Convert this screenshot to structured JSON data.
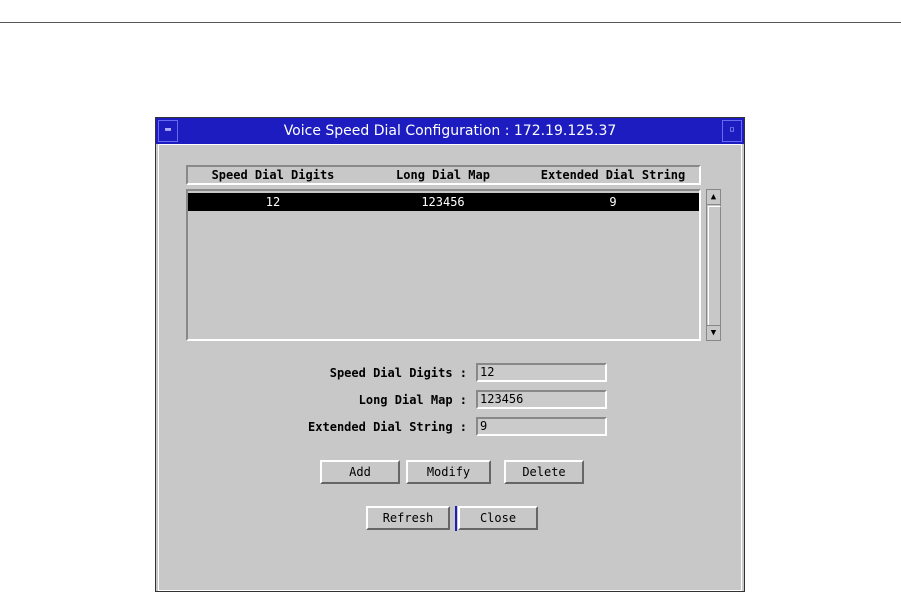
{
  "window": {
    "title": "Voice Speed Dial Configuration : 172.19.125.37",
    "menu_icon": "window-menu-icon",
    "maximize_icon": "maximize-icon"
  },
  "table": {
    "columns": [
      "Speed Dial Digits",
      "Long Dial Map",
      "Extended Dial String"
    ],
    "rows": [
      [
        "12",
        "123456",
        "9"
      ]
    ]
  },
  "form": {
    "speed_label": "Speed Dial Digits :",
    "speed_value": "12",
    "long_label": "Long Dial Map :",
    "long_value": "123456",
    "ext_label": "Extended Dial String :",
    "ext_value": "9"
  },
  "buttons": {
    "add": "Add",
    "modify": "Modify",
    "delete": "Delete",
    "refresh": "Refresh",
    "close": "Close"
  },
  "colors": {
    "titlebar": "#1c1cc0",
    "background": "#c8c8c8",
    "selected_row": "#000000"
  }
}
